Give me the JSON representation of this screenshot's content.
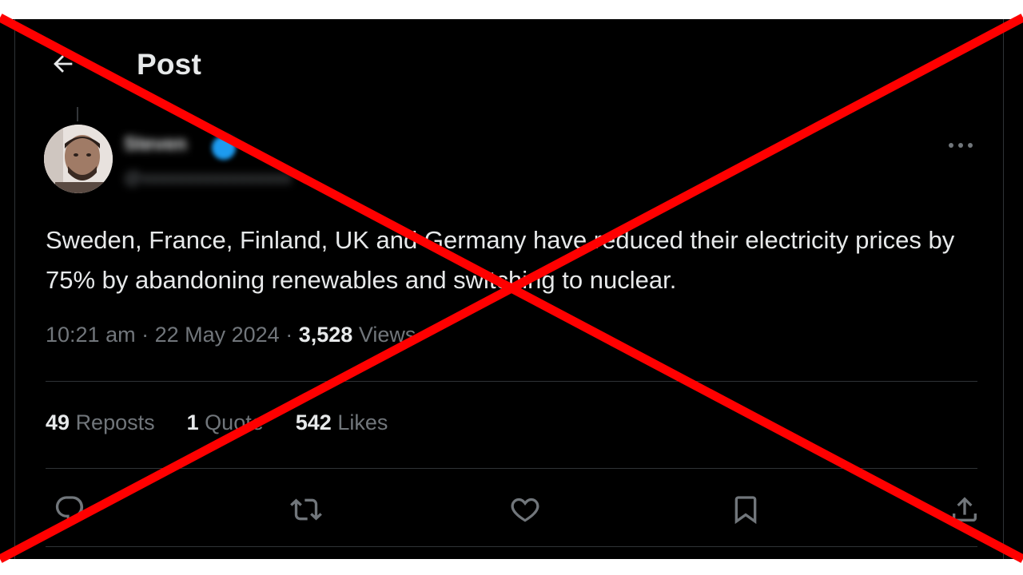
{
  "header": {
    "back_icon": "arrow-left-icon",
    "title": "Post"
  },
  "author": {
    "name": "Steven",
    "handle": "@ ",
    "verified_badge_color": "#1d9bf0"
  },
  "post": {
    "text": "Sweden, France, Finland, UK and Germany have reduced their electricity prices by 75% by abandoning renewables and switching to nuclear.",
    "time": "10:21 am",
    "date": "22 May 2024",
    "views_count": "3,528",
    "views_label": "Views"
  },
  "stats": {
    "reposts_count": "49",
    "reposts_label": "Reposts",
    "quotes_count": "1",
    "quotes_label": "Quote",
    "likes_count": "542",
    "likes_label": "Likes"
  },
  "actions": {
    "reply_icon": "reply-icon",
    "repost_icon": "repost-icon",
    "like_icon": "heart-icon",
    "bookmark_icon": "bookmark-icon",
    "share_icon": "share-icon"
  },
  "colors": {
    "background": "#000000",
    "text_primary": "#e7e9ea",
    "text_secondary": "#71767b",
    "divider": "#2f3336",
    "cross_overlay": "#ff0000"
  }
}
